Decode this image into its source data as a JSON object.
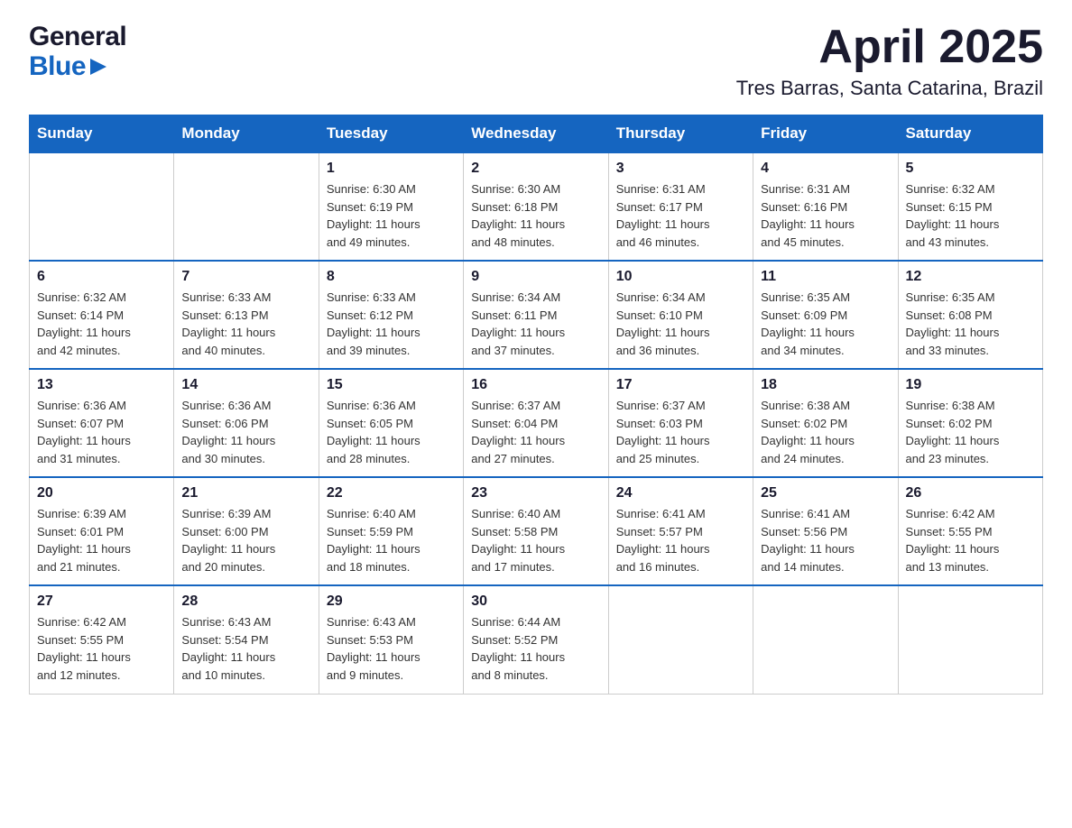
{
  "logo": {
    "line1": "General",
    "line2": "Blue"
  },
  "header": {
    "month": "April 2025",
    "location": "Tres Barras, Santa Catarina, Brazil"
  },
  "weekdays": [
    "Sunday",
    "Monday",
    "Tuesday",
    "Wednesday",
    "Thursday",
    "Friday",
    "Saturday"
  ],
  "weeks": [
    [
      {
        "day": "",
        "info": ""
      },
      {
        "day": "",
        "info": ""
      },
      {
        "day": "1",
        "info": "Sunrise: 6:30 AM\nSunset: 6:19 PM\nDaylight: 11 hours\nand 49 minutes."
      },
      {
        "day": "2",
        "info": "Sunrise: 6:30 AM\nSunset: 6:18 PM\nDaylight: 11 hours\nand 48 minutes."
      },
      {
        "day": "3",
        "info": "Sunrise: 6:31 AM\nSunset: 6:17 PM\nDaylight: 11 hours\nand 46 minutes."
      },
      {
        "day": "4",
        "info": "Sunrise: 6:31 AM\nSunset: 6:16 PM\nDaylight: 11 hours\nand 45 minutes."
      },
      {
        "day": "5",
        "info": "Sunrise: 6:32 AM\nSunset: 6:15 PM\nDaylight: 11 hours\nand 43 minutes."
      }
    ],
    [
      {
        "day": "6",
        "info": "Sunrise: 6:32 AM\nSunset: 6:14 PM\nDaylight: 11 hours\nand 42 minutes."
      },
      {
        "day": "7",
        "info": "Sunrise: 6:33 AM\nSunset: 6:13 PM\nDaylight: 11 hours\nand 40 minutes."
      },
      {
        "day": "8",
        "info": "Sunrise: 6:33 AM\nSunset: 6:12 PM\nDaylight: 11 hours\nand 39 minutes."
      },
      {
        "day": "9",
        "info": "Sunrise: 6:34 AM\nSunset: 6:11 PM\nDaylight: 11 hours\nand 37 minutes."
      },
      {
        "day": "10",
        "info": "Sunrise: 6:34 AM\nSunset: 6:10 PM\nDaylight: 11 hours\nand 36 minutes."
      },
      {
        "day": "11",
        "info": "Sunrise: 6:35 AM\nSunset: 6:09 PM\nDaylight: 11 hours\nand 34 minutes."
      },
      {
        "day": "12",
        "info": "Sunrise: 6:35 AM\nSunset: 6:08 PM\nDaylight: 11 hours\nand 33 minutes."
      }
    ],
    [
      {
        "day": "13",
        "info": "Sunrise: 6:36 AM\nSunset: 6:07 PM\nDaylight: 11 hours\nand 31 minutes."
      },
      {
        "day": "14",
        "info": "Sunrise: 6:36 AM\nSunset: 6:06 PM\nDaylight: 11 hours\nand 30 minutes."
      },
      {
        "day": "15",
        "info": "Sunrise: 6:36 AM\nSunset: 6:05 PM\nDaylight: 11 hours\nand 28 minutes."
      },
      {
        "day": "16",
        "info": "Sunrise: 6:37 AM\nSunset: 6:04 PM\nDaylight: 11 hours\nand 27 minutes."
      },
      {
        "day": "17",
        "info": "Sunrise: 6:37 AM\nSunset: 6:03 PM\nDaylight: 11 hours\nand 25 minutes."
      },
      {
        "day": "18",
        "info": "Sunrise: 6:38 AM\nSunset: 6:02 PM\nDaylight: 11 hours\nand 24 minutes."
      },
      {
        "day": "19",
        "info": "Sunrise: 6:38 AM\nSunset: 6:02 PM\nDaylight: 11 hours\nand 23 minutes."
      }
    ],
    [
      {
        "day": "20",
        "info": "Sunrise: 6:39 AM\nSunset: 6:01 PM\nDaylight: 11 hours\nand 21 minutes."
      },
      {
        "day": "21",
        "info": "Sunrise: 6:39 AM\nSunset: 6:00 PM\nDaylight: 11 hours\nand 20 minutes."
      },
      {
        "day": "22",
        "info": "Sunrise: 6:40 AM\nSunset: 5:59 PM\nDaylight: 11 hours\nand 18 minutes."
      },
      {
        "day": "23",
        "info": "Sunrise: 6:40 AM\nSunset: 5:58 PM\nDaylight: 11 hours\nand 17 minutes."
      },
      {
        "day": "24",
        "info": "Sunrise: 6:41 AM\nSunset: 5:57 PM\nDaylight: 11 hours\nand 16 minutes."
      },
      {
        "day": "25",
        "info": "Sunrise: 6:41 AM\nSunset: 5:56 PM\nDaylight: 11 hours\nand 14 minutes."
      },
      {
        "day": "26",
        "info": "Sunrise: 6:42 AM\nSunset: 5:55 PM\nDaylight: 11 hours\nand 13 minutes."
      }
    ],
    [
      {
        "day": "27",
        "info": "Sunrise: 6:42 AM\nSunset: 5:55 PM\nDaylight: 11 hours\nand 12 minutes."
      },
      {
        "day": "28",
        "info": "Sunrise: 6:43 AM\nSunset: 5:54 PM\nDaylight: 11 hours\nand 10 minutes."
      },
      {
        "day": "29",
        "info": "Sunrise: 6:43 AM\nSunset: 5:53 PM\nDaylight: 11 hours\nand 9 minutes."
      },
      {
        "day": "30",
        "info": "Sunrise: 6:44 AM\nSunset: 5:52 PM\nDaylight: 11 hours\nand 8 minutes."
      },
      {
        "day": "",
        "info": ""
      },
      {
        "day": "",
        "info": ""
      },
      {
        "day": "",
        "info": ""
      }
    ]
  ]
}
